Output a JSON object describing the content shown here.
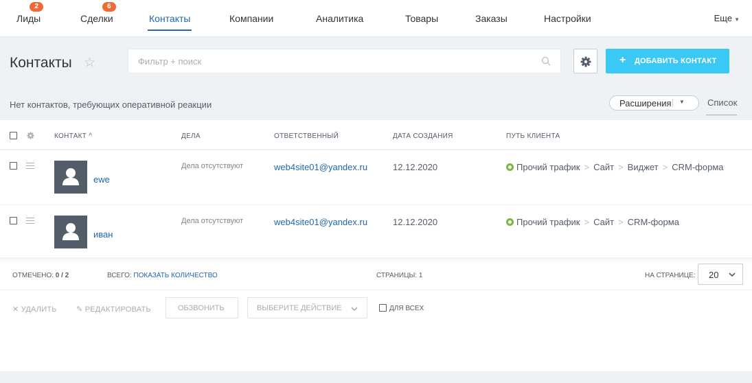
{
  "nav": {
    "items": [
      {
        "label": "Лиды",
        "badge": "2"
      },
      {
        "label": "Сделки",
        "badge": "6"
      },
      {
        "label": "Контакты",
        "badge": null
      },
      {
        "label": "Компании",
        "badge": null
      },
      {
        "label": "Аналитика",
        "badge": null
      },
      {
        "label": "Товары",
        "badge": null
      },
      {
        "label": "Заказы",
        "badge": null
      },
      {
        "label": "Настройки",
        "badge": null
      }
    ],
    "more_label": "Еще",
    "active_index": 2
  },
  "header": {
    "title": "Контакты",
    "search_placeholder": "Фильтр + поиск",
    "add_button_label": "ДОБАВИТЬ КОНТАКТ"
  },
  "notice": {
    "text": "Нет контактов, требующих оперативной реакции",
    "extensions_label": "Расширения",
    "view_label": "Список"
  },
  "table": {
    "columns": [
      "КОНТАКТ",
      "ДЕЛА",
      "ОТВЕТСТВЕННЫЙ",
      "ДАТА СОЗДАНИЯ",
      "ПУТЬ КЛИЕНТА"
    ],
    "sort_indicator": "^",
    "rows": [
      {
        "name": "ewe",
        "deals": "Дела отсутствуют",
        "responsible": "web4site01@yandex.ru",
        "created": "12.12.2020",
        "path": [
          "Прочий трафик",
          "Сайт",
          "Виджет",
          "CRM-форма"
        ]
      },
      {
        "name": "иван",
        "deals": "Дела отсутствуют",
        "responsible": "web4site01@yandex.ru",
        "created": "12.12.2020",
        "path": [
          "Прочий трафик",
          "Сайт",
          "CRM-форма"
        ]
      }
    ]
  },
  "footer": {
    "selected_label": "ОТМЕЧЕНО:",
    "selected_value": "0 / 2",
    "total_label": "ВСЕГО:",
    "total_link": "ПОКАЗАТЬ КОЛИЧЕСТВО",
    "pages_label": "СТРАНИЦЫ:",
    "pages_value": "1",
    "per_page_label": "НА СТРАНИЦЕ:",
    "per_page_value": "20"
  },
  "actions": {
    "delete_label": "УДАЛИТЬ",
    "edit_label": "РЕДАКТИРОВАТЬ",
    "call_label": "ОБЗВОНИТЬ",
    "select_action_label": "ВЫБЕРИТЕ ДЕЙСТВИЕ",
    "for_all_label": "ДЛЯ ВСЕХ"
  },
  "colors": {
    "accent": "#2067b0",
    "add_button": "#3bc8f5",
    "badge": "#f06a36",
    "path_dot": "#7bb73b"
  }
}
